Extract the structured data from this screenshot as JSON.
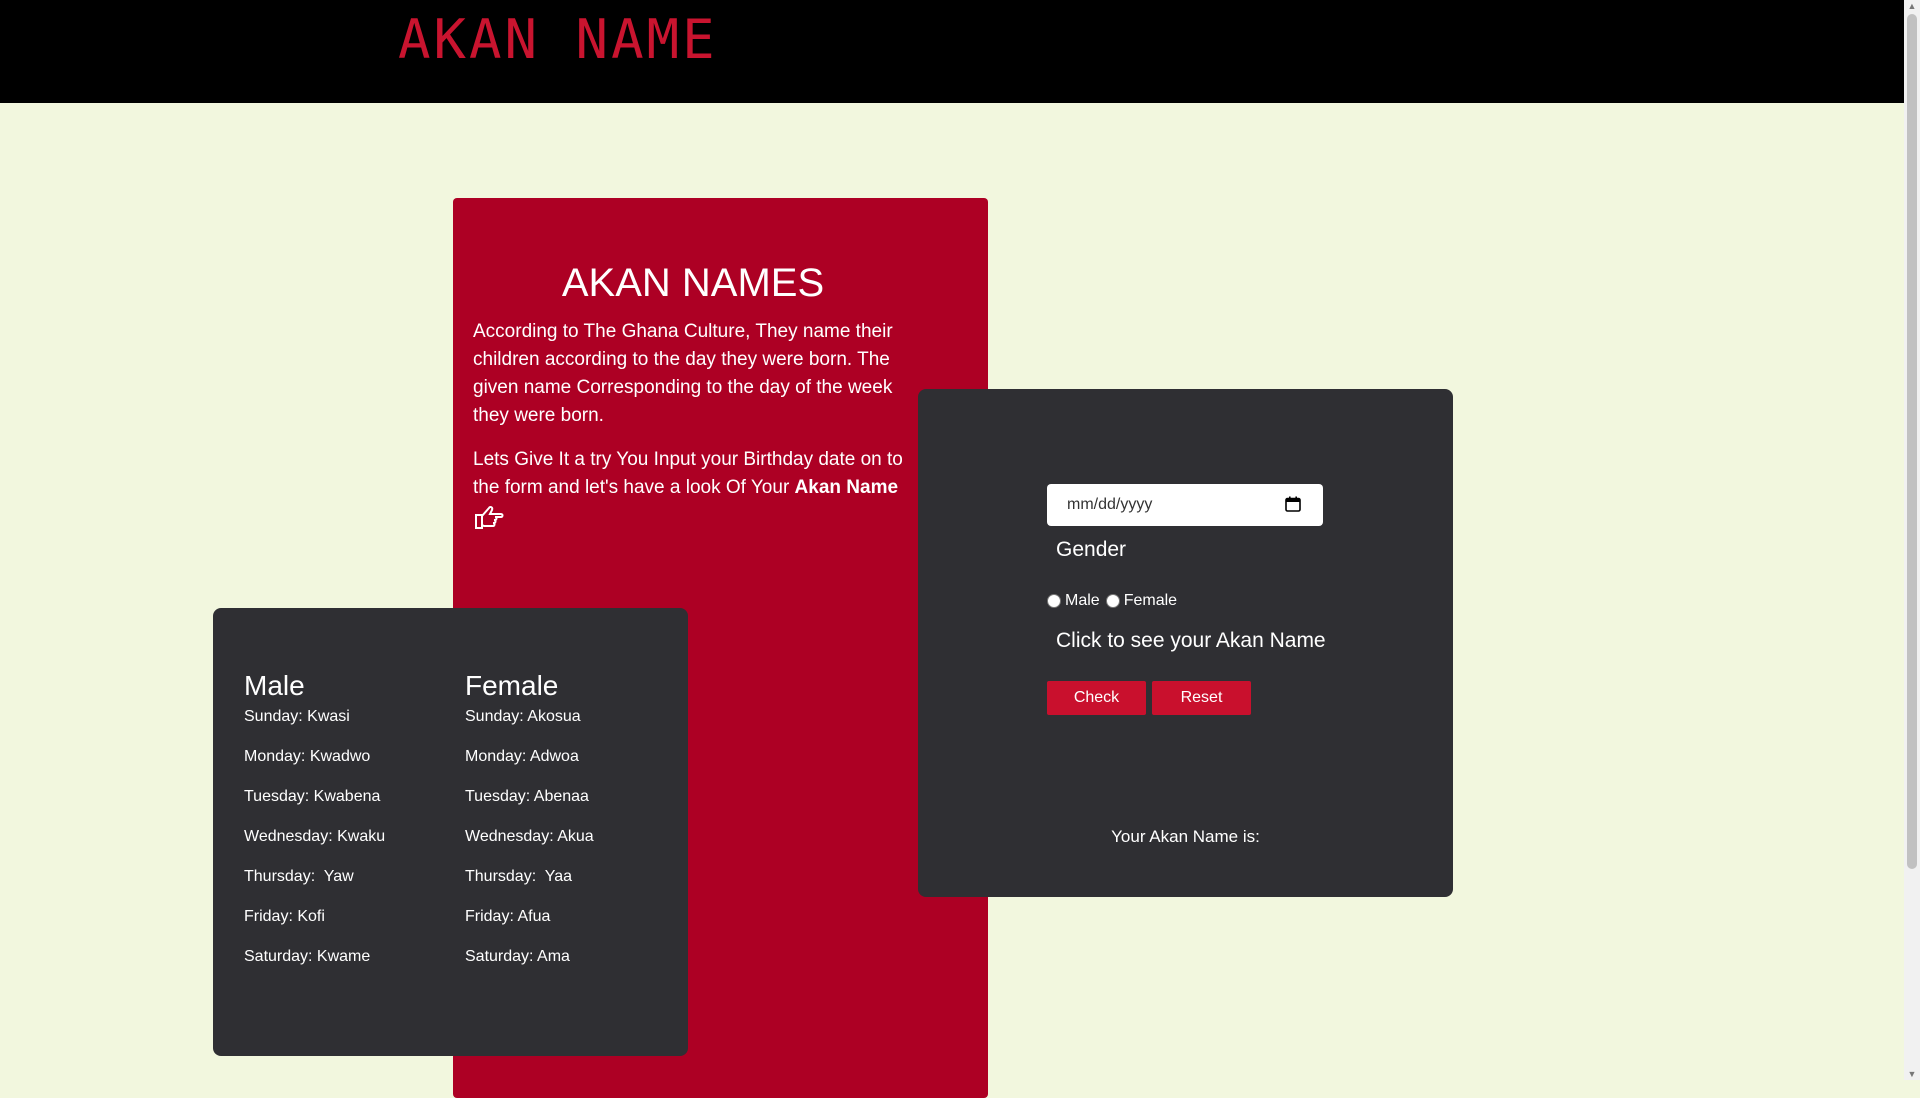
{
  "header": {
    "brand": "AKAN NAME"
  },
  "info": {
    "title": "AKAN NAMES",
    "paragraph1": "According to The Ghana Culture, They name their children according to the day they were born. The given name Corresponding to the day of the week they were born.",
    "paragraph2": "Lets Give It a try You Input your Birthday date on to the form and let's have a look Of Your ",
    "paragraph2_bold": "Akan Name",
    "pointer_icon": "hand-pointing-right-icon"
  },
  "names": {
    "male": {
      "heading": "Male",
      "entries": [
        "Sunday: Kwasi",
        "Monday: Kwadwo",
        "Tuesday: Kwabena",
        "Wednesday: Kwaku",
        "Thursday:  Yaw",
        "Friday: Kofi",
        "Saturday: Kwame"
      ]
    },
    "female": {
      "heading": "Female",
      "entries": [
        "Sunday: Akosua",
        "Monday: Adwoa",
        "Tuesday: Abenaa",
        "Wednesday: Akua",
        "Thursday:  Yaa",
        "Friday: Afua",
        "Saturday: Ama"
      ]
    }
  },
  "form": {
    "date_placeholder": "mm/dd/yyyy",
    "gender_label": "Gender",
    "male_label": "Male",
    "female_label": "Female",
    "click_label": "Click to see your Akan Name",
    "check_button": "Check",
    "reset_button": "Reset",
    "result_label": "Your Akan Name is:"
  },
  "colors": {
    "accent": "#c9142f",
    "card_red": "#ad0024",
    "card_dark": "#2f2f33",
    "background": "#f2f7de"
  }
}
